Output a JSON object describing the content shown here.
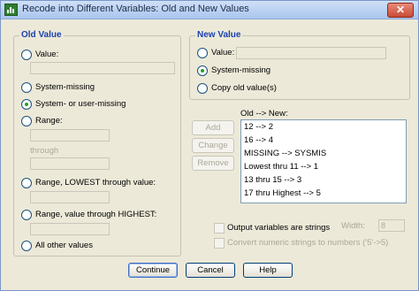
{
  "window": {
    "title": "Recode into Different Variables: Old and New Values",
    "close_label": "✕"
  },
  "old_value": {
    "title": "Old Value",
    "value_label": "Value:",
    "system_missing_label": "System-missing",
    "system_or_user_missing_label": "System- or user-missing",
    "range_label": "Range:",
    "through_label": "through",
    "range_lowest_label": "Range, LOWEST through value:",
    "range_highest_label": "Range, value through HIGHEST:",
    "all_other_label": "All other values",
    "selected": "system_or_user_missing"
  },
  "new_value": {
    "title": "New Value",
    "value_label": "Value:",
    "system_missing_label": "System-missing",
    "copy_old_label": "Copy old value(s)",
    "selected": "system_missing"
  },
  "mapping": {
    "header": "Old --> New:",
    "items": [
      "12 --> 2",
      "16 --> 4",
      "MISSING --> SYSMIS",
      "Lowest thru 11 --> 1",
      "13 thru 15 --> 3",
      "17 thru Highest --> 5"
    ],
    "add_label": "Add",
    "change_label": "Change",
    "remove_label": "Remove"
  },
  "options": {
    "output_strings_label": "Output variables are strings",
    "width_label": "Width:",
    "width_value": "8",
    "convert_numeric_label": "Convert numeric strings to numbers ('5'->5)"
  },
  "footer": {
    "continue_label": "Continue",
    "cancel_label": "Cancel",
    "help_label": "Help"
  }
}
